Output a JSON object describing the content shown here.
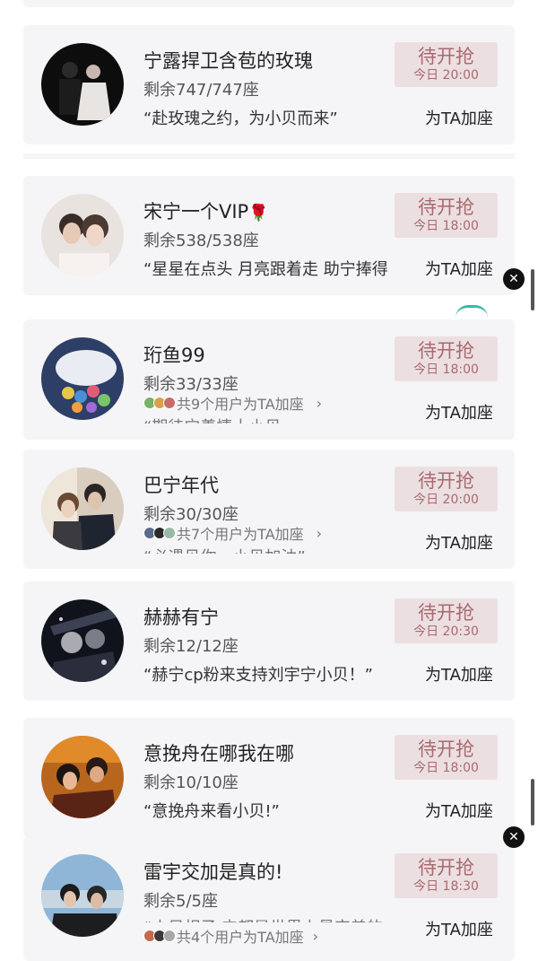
{
  "cards": [
    {
      "name": "宁露捍卫含苞的玫瑰",
      "seats": "剩余747/747座",
      "quote": "“赴玫瑰之约，为小贝而来”",
      "grab_label": "待开抢",
      "grab_time": "今日 20:00",
      "add_label": "为TA加座"
    },
    {
      "name": "宋宁一个VIP",
      "name_emoji": "🌹",
      "seats": "剩余538/538座",
      "quote": "“星星在点头 月亮跟着走 助宁捧得",
      "grab_label": "待开抢",
      "grab_time": "今日 18:00",
      "add_label": "为TA加座"
    },
    {
      "name": "珩鱼99",
      "seats": "剩余33/33座",
      "supporters": "共9个用户为TA加座",
      "quote_clipped": "“期待宁羡情十小贝",
      "grab_label": "待开抢",
      "grab_time": "今日 18:00",
      "add_label": "为TA加座"
    },
    {
      "name": "巴宁年代",
      "seats": "剩余30/30座",
      "supporters": "共7个用户为TA加座",
      "quote_clipped": "“必遇见你，小贝加油”",
      "grab_label": "待开抢",
      "grab_time": "今日 20:00",
      "add_label": "为TA加座"
    },
    {
      "name": "赫赫有宁",
      "seats": "剩余12/12座",
      "quote": "“赫宁cp粉来支持刘宇宁小贝！”",
      "grab_label": "待开抢",
      "grab_time": "今日 20:30",
      "add_label": "为TA加座"
    },
    {
      "name": "意挽舟在哪我在哪",
      "seats": "剩余10/10座",
      "quote": "“意挽舟来看小贝!”",
      "grab_label": "待开抢",
      "grab_time": "今日 18:00",
      "add_label": "为TA加座"
    },
    {
      "name": "雷宇交加是真的!",
      "seats": "剩余5/5座",
      "quote_clipped": "“小贝相子 宁都是世界上最完美的",
      "supporters": "共4个用户为TA加座",
      "grab_label": "待开抢",
      "grab_time": "今日 18:30",
      "add_label": "为TA加座"
    }
  ],
  "icons": {
    "close": "close-icon",
    "chevron": "chevron-right-icon",
    "rose": "rose-emoji"
  },
  "colors": {
    "card_bg": "#f5f4f6",
    "button_bg": "#ecdfe1",
    "button_text": "#a86a70"
  }
}
